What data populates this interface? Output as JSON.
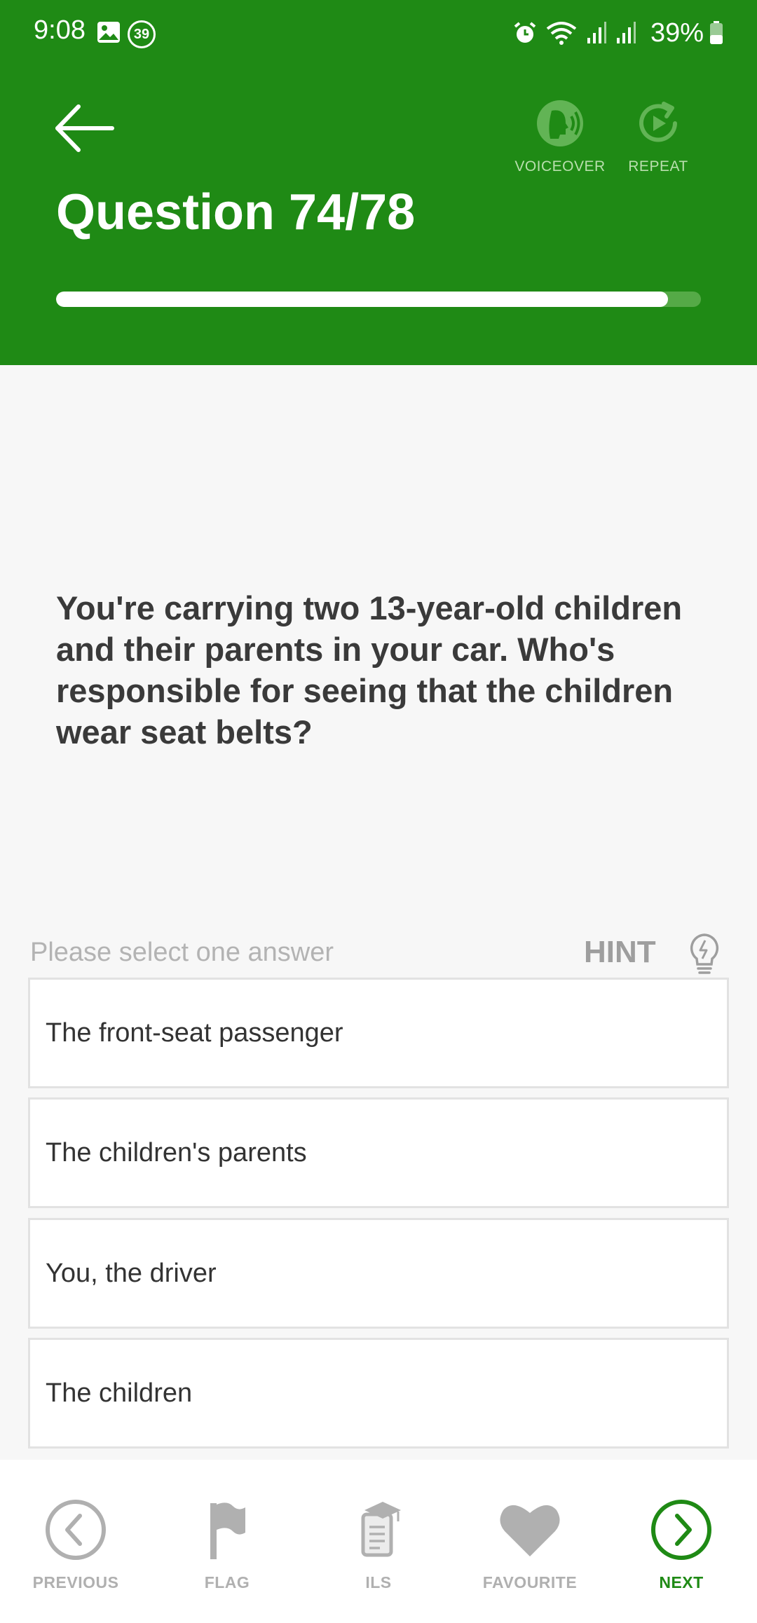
{
  "status_bar": {
    "time": "9:08",
    "notification_badge": "39",
    "battery_percent": "39%",
    "icons": [
      "gallery-icon",
      "alarm-icon",
      "wifi-icon",
      "signal-icon",
      "signal-icon",
      "battery-icon"
    ]
  },
  "header": {
    "title": "Question 74/78",
    "voiceover_label": "VOICEOVER",
    "repeat_label": "REPEAT",
    "progress_fraction": 0.949
  },
  "question": {
    "text": "You're carrying two 13-year-old children and their parents in your car. Who's responsible for seeing that the children wear seat belts?"
  },
  "answers": {
    "prompt": "Please select one answer",
    "hint_label": "HINT",
    "options": [
      {
        "label": "The front-seat passenger",
        "selected": false
      },
      {
        "label": "The children's parents",
        "selected": false
      },
      {
        "label": "You, the driver",
        "selected": true
      },
      {
        "label": "The children",
        "selected": false
      }
    ]
  },
  "bottom_nav": {
    "previous": "PREVIOUS",
    "flag": "FLAG",
    "ils": "ILS",
    "favourite": "FAVOURITE",
    "next": "NEXT"
  },
  "colors": {
    "primary": "#1f8a15",
    "inactive": "#b0b0b0",
    "question_text": "#3a3a3a"
  }
}
